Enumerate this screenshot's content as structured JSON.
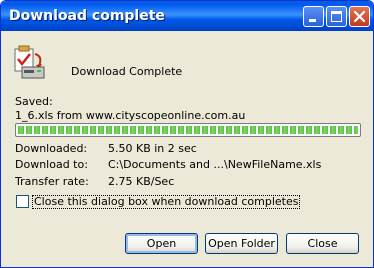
{
  "window": {
    "title": "Download complete",
    "controls": {
      "minimize": "minimize-icon",
      "maximize": "maximize-icon",
      "close": "close-icon"
    }
  },
  "header": {
    "text": "Download Complete",
    "icon": "download-complete-icon"
  },
  "saved": {
    "label": "Saved:",
    "file_info": "1_6.xls from www.cityscopeonline.com.au"
  },
  "progress": {
    "percent": 100
  },
  "details": [
    {
      "label": "Downloaded:",
      "value": "5.50 KB in 2 sec"
    },
    {
      "label": "Download to:",
      "value": "C:\\Documents and ...\\NewFileName.xls"
    },
    {
      "label": "Transfer rate:",
      "value": "2.75 KB/Sec"
    }
  ],
  "checkbox": {
    "label": "Close this dialog box when download completes",
    "checked": false
  },
  "buttons": {
    "open": "Open",
    "open_folder": "Open Folder",
    "close": "Close"
  },
  "colors": {
    "titlebar": "#0058ee",
    "dialog_bg": "#ece9d8",
    "progress": "#52c13c"
  }
}
